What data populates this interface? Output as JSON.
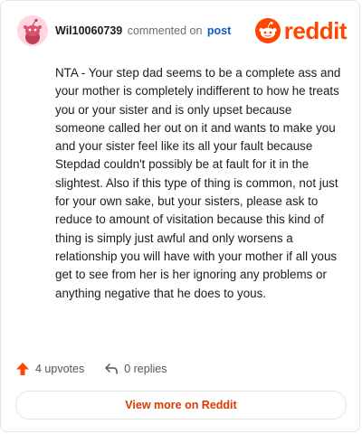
{
  "comment": {
    "username": "Wil10060739",
    "action_text": "commented on",
    "post_link_label": "post",
    "body": "NTA - Your step dad seems to be a complete ass and your mother is completely indifferent to how he treats you or your sister and is only upset because someone called her out on it and wants to make you and your sister feel like its all your fault because Stepdad couldn't possibly be at fault for it in the slightest. Also if this type of thing is common, not just for your own sake, but your sisters, please ask to reduce to amount of visitation because this kind of thing is simply just awful and only worsens a relationship you will have with your mother if all yous get to see from her is her ignoring any problems or anything negative that he does to yous."
  },
  "brand": {
    "wordmark": "reddit",
    "accent_color": "#ff4500"
  },
  "stats": {
    "upvotes": "4 upvotes",
    "replies": "0 replies"
  },
  "footer": {
    "view_more_label": "View more on Reddit"
  }
}
